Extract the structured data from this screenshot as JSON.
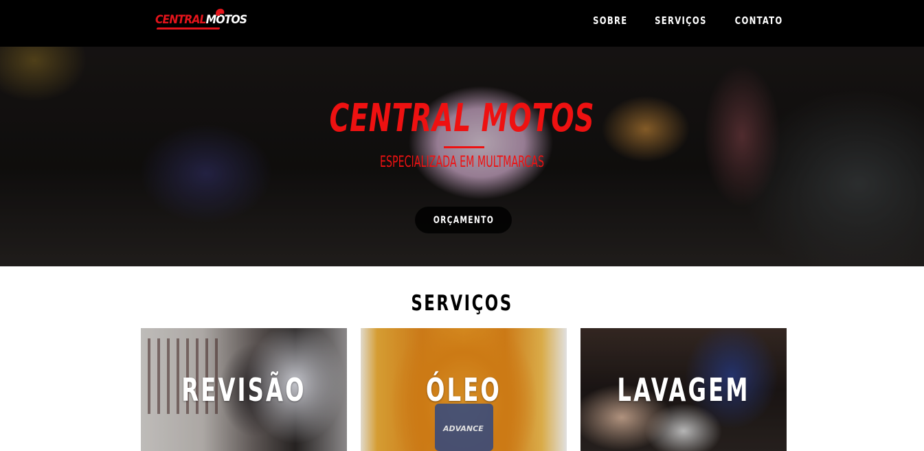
{
  "navbar": {
    "logo": {
      "part1": "CENTRAL",
      "part2": "MOTOS"
    },
    "links": [
      {
        "label": "SOBRE"
      },
      {
        "label": "SERVIÇOS"
      },
      {
        "label": "CONTATO"
      }
    ]
  },
  "hero": {
    "title": "CENTRAL MOTOS",
    "subtitle": "ESPECIALIZADA EM MULTMARCAS",
    "button_label": "ORÇAMENTO"
  },
  "services": {
    "title": "SERVIÇOS",
    "cards": [
      {
        "label": "REVISÃO"
      },
      {
        "label": "ÓLEO"
      },
      {
        "label": "LAVAGEM"
      }
    ],
    "oil_bottle_text": "ADVANCE"
  },
  "colors": {
    "accent": "#ee1111",
    "navbar_bg": "#000000",
    "button_bg": "#000000"
  },
  "icons": [
    "logo-helmet-icon"
  ]
}
